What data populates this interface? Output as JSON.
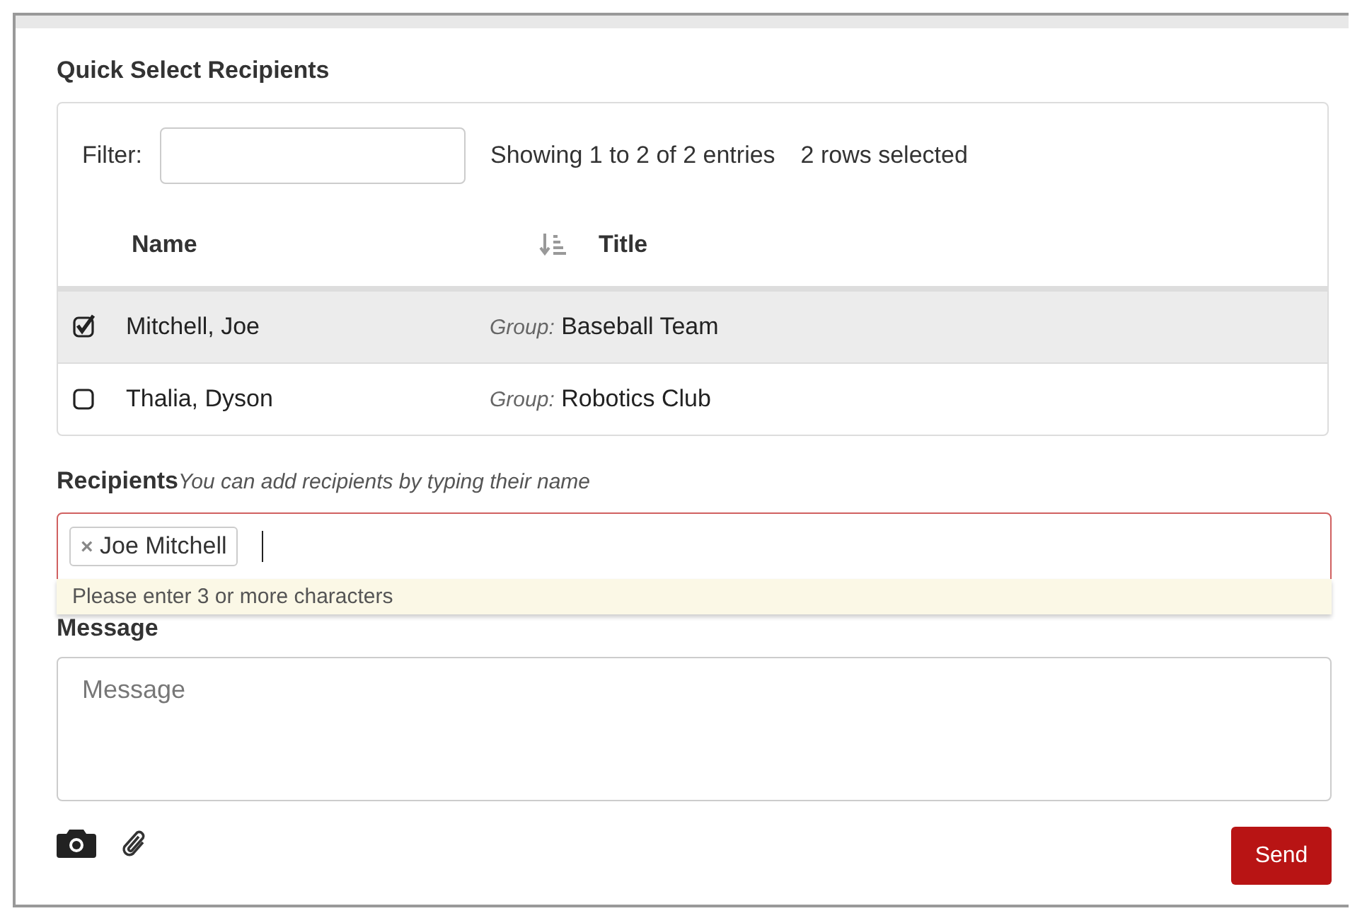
{
  "title": "Quick Select Recipients",
  "filter": {
    "label": "Filter:"
  },
  "info": "Showing 1 to 2 of 2 entries",
  "selection_info": "2 rows selected",
  "table": {
    "columns": [
      "Name",
      "Title"
    ],
    "rows": [
      {
        "name": "Mitchell, Joe",
        "group_label": "Group:",
        "group": "Baseball Team",
        "selected": true
      },
      {
        "name": "Thalia, Dyson",
        "group_label": "Group:",
        "group": "Robotics Club",
        "selected": false
      }
    ]
  },
  "recipients": {
    "label": "Recipients",
    "hint": "You can add recipients by typing their name",
    "tags": [
      "Joe Mitchell"
    ],
    "tag_remove": "×",
    "invalid": true,
    "suggestion": "Please enter 3 or more characters"
  },
  "message": {
    "label": "Message",
    "placeholder": "Message"
  },
  "send_button": "Send"
}
